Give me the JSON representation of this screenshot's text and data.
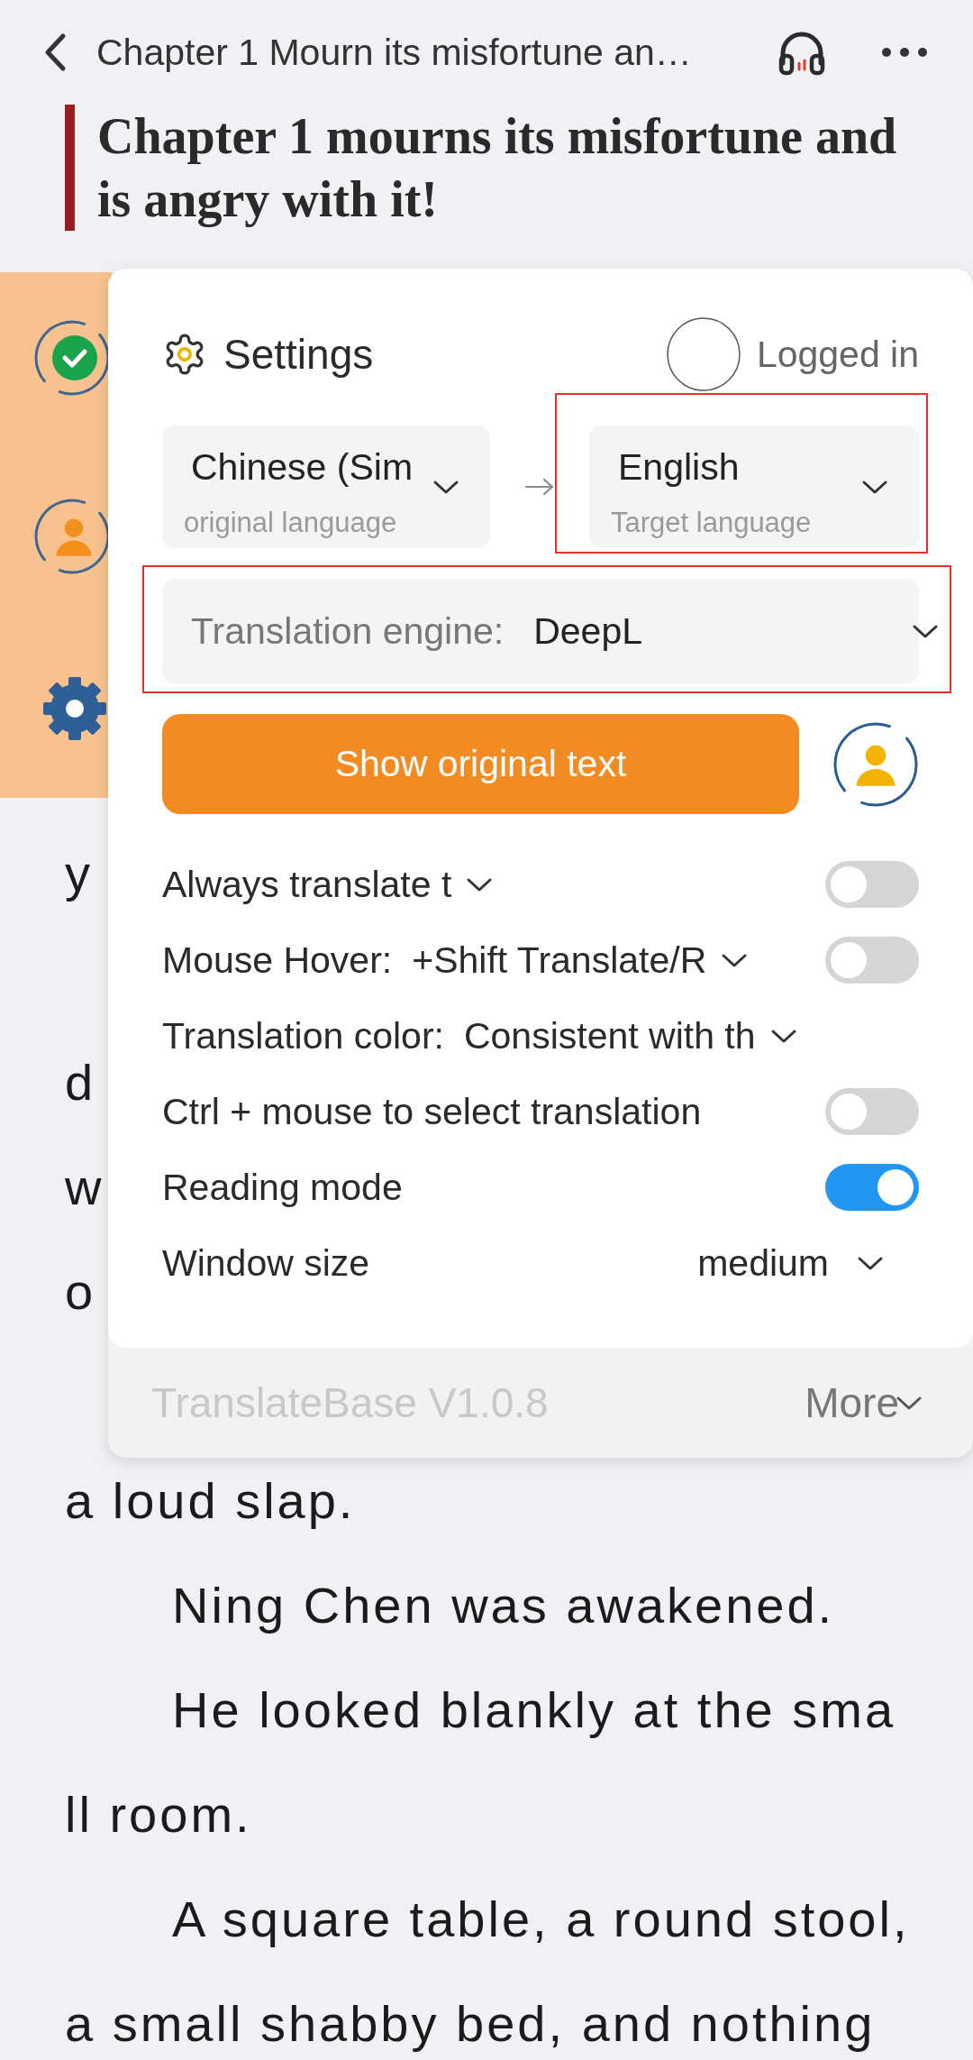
{
  "header": {
    "title": "Chapter 1 Mourn its misfortune an…"
  },
  "chapter_heading": "Chapter 1 mourns its misfortune and is angry with it!",
  "popup": {
    "title": "Settings",
    "account_status": "Logged in",
    "source_language": {
      "value": "Chinese (Sim",
      "caption": "original language",
      "highlighted": false
    },
    "target_language": {
      "value": "English",
      "caption": "Target language",
      "highlighted": true
    },
    "engine": {
      "label": "Translation engine:",
      "value": "DeepL",
      "highlighted": true
    },
    "primary_button": "Show original text",
    "rows": [
      {
        "kind": "dropdown_toggle",
        "value": "Always translate t",
        "on": false
      },
      {
        "kind": "dropdown_toggle",
        "label": "Mouse Hover:",
        "value": "+Shift Translate/R",
        "on": false
      },
      {
        "kind": "dropdown",
        "label": "Translation color:",
        "value": "Consistent with th"
      },
      {
        "kind": "toggle",
        "label": "Ctrl + mouse to select translation",
        "on": false
      },
      {
        "kind": "toggle",
        "label": "Reading mode",
        "on": true
      },
      {
        "kind": "choice",
        "label": "Window size",
        "value": "medium"
      }
    ],
    "footer": {
      "version": "TranslateBase V1.0.8",
      "more": "More"
    }
  },
  "body": {
    "lines": [
      "y",
      "d",
      "w",
      "o",
      "a loud slap.",
      "Ning Chen was awakened.",
      "He looked blankly at the sma",
      "ll room.",
      "A square table, a round stool,",
      "a small shabby bed, and nothing"
    ]
  }
}
